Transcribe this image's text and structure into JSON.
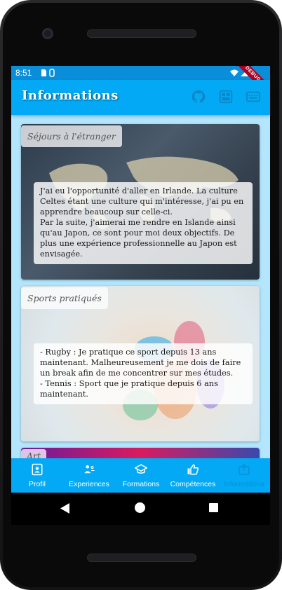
{
  "status_bar": {
    "time": "8:51",
    "debug_label": "DEBUG"
  },
  "app_bar": {
    "title": "Informations",
    "actions": [
      "github-icon",
      "view-icon",
      "keyboard-icon"
    ]
  },
  "cards": [
    {
      "title": "Séjours à l'étranger",
      "text": "J'ai eu l'opportunité d'aller en Irlande. La culture Celtes étant une culture qui m'intéresse, j'ai pu en apprendre beaucoup sur celle-ci.\nPar la suite, j'aimerai me rendre en Islande ainsi qu'au Japon, ce sont pour moi deux objectifs. De plus une expérience professionnelle au Japon est envisagée."
    },
    {
      "title": "Sports pratiqués",
      "text": "- Rugby : Je pratique ce sport depuis 13 ans maintenant. Malheureusement je me dois de faire un break afin de me concentrer sur mes études.\n- Tennis : Sport que je pratique depuis 6 ans maintenant."
    },
    {
      "title": "Art"
    }
  ],
  "bottom_nav": {
    "items": [
      {
        "label": "Profil",
        "icon": "profile-icon",
        "active": false
      },
      {
        "label": "Experiences",
        "icon": "experiences-icon",
        "active": false
      },
      {
        "label": "Formations",
        "icon": "school-icon",
        "active": false
      },
      {
        "label": "Compétences",
        "icon": "thumbs-up-icon",
        "active": false
      },
      {
        "label": "Informations",
        "icon": "info-icon",
        "active": true
      }
    ]
  },
  "colors": {
    "app_bar": "#03a9f4",
    "status_bar": "#0a8ed9",
    "background": "#b3e5fc",
    "active_nav": "#0a8ed9"
  }
}
